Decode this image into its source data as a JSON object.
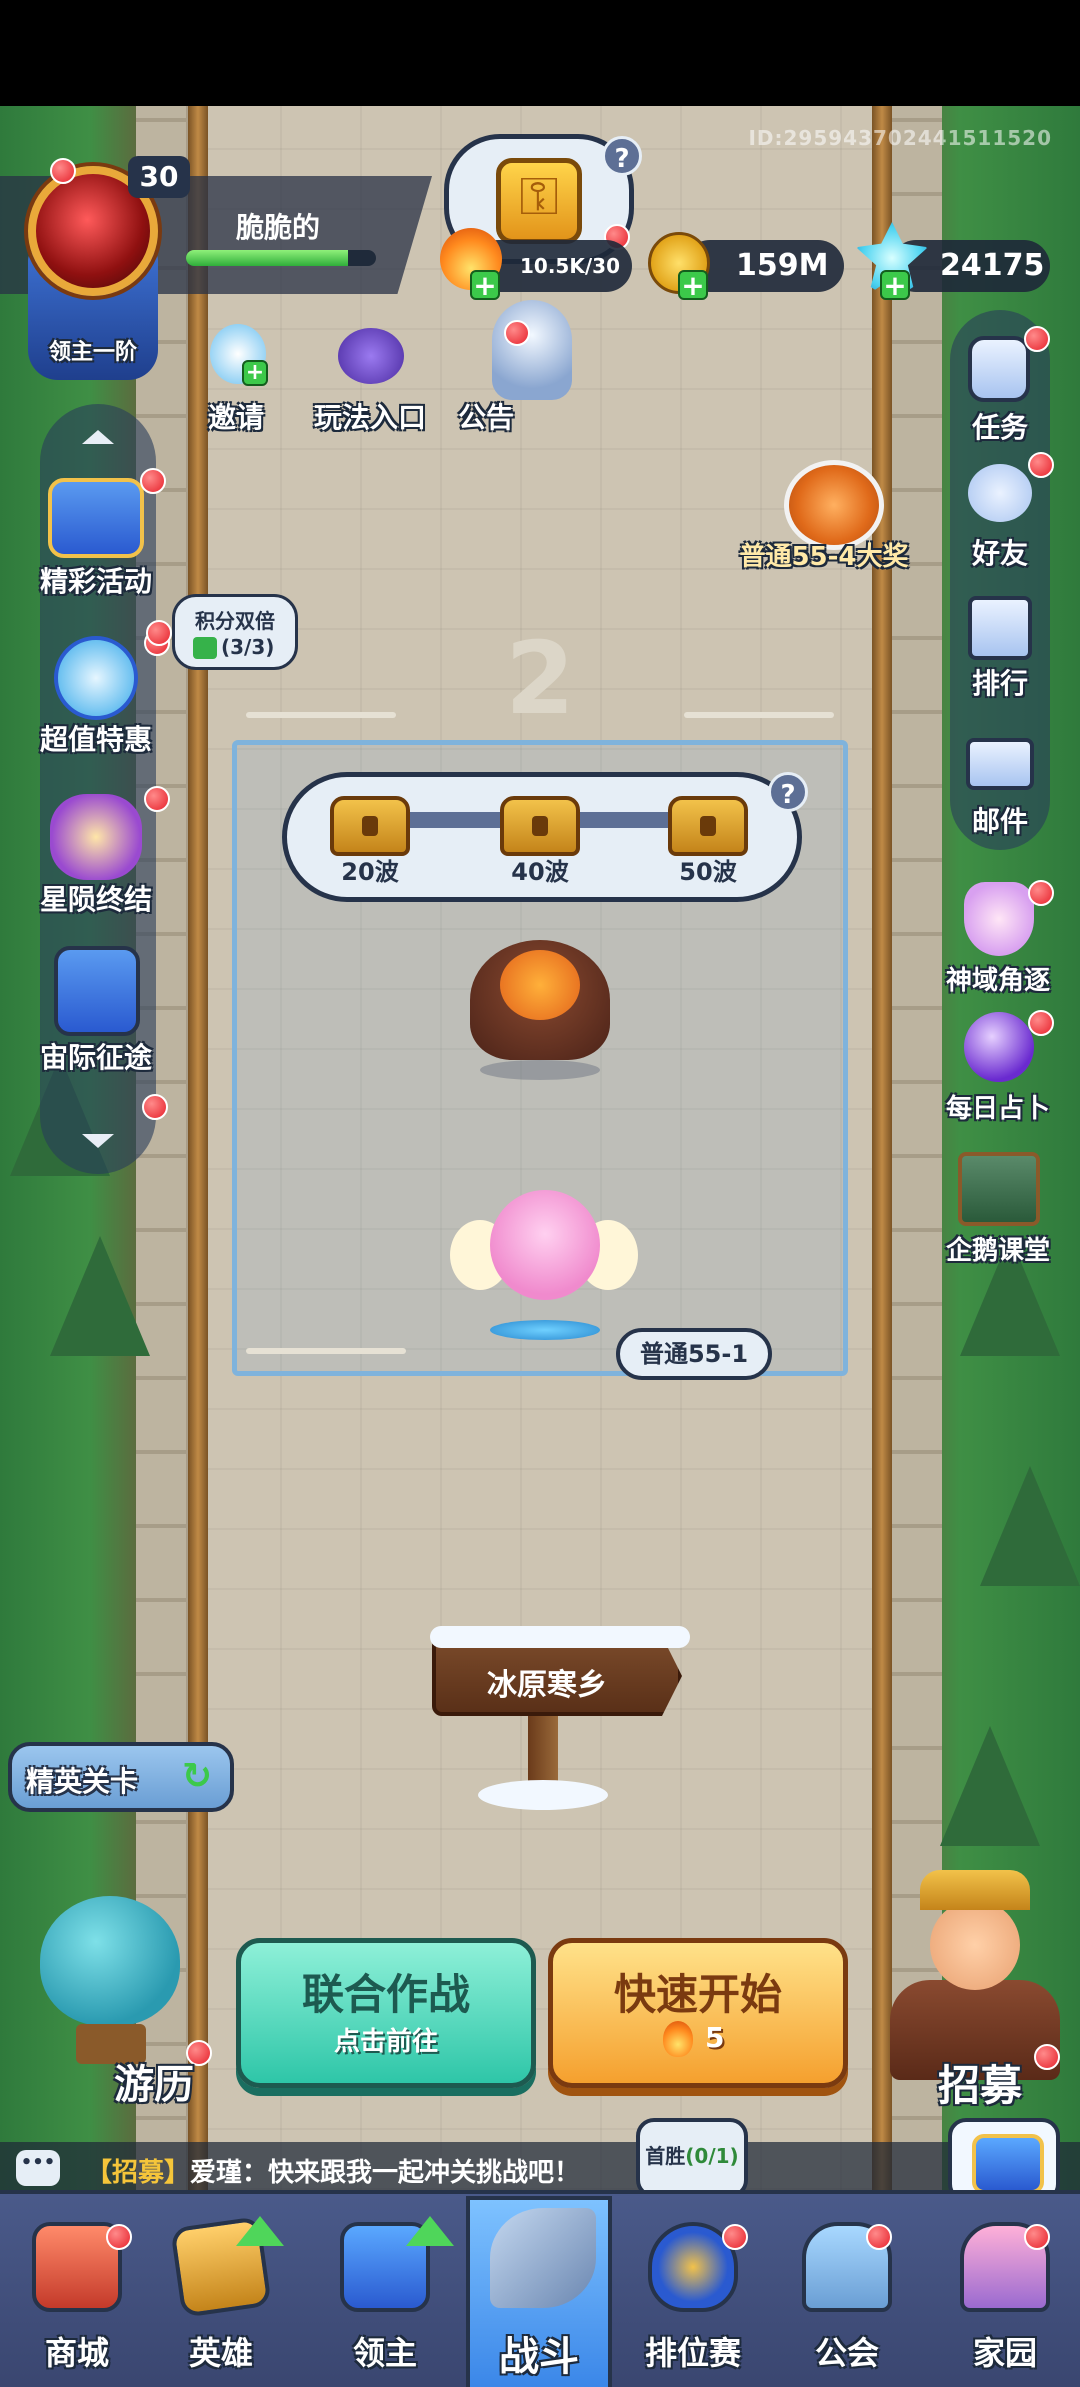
{
  "top": {
    "player_id": "ID:295943702441511520"
  },
  "player": {
    "name": "脆脆的",
    "level": "30",
    "rank": "领主一阶",
    "exp_fraction": 0.85
  },
  "resources": {
    "energy": "10.5K/30",
    "gold": "159M",
    "gems": "24175",
    "help": "?"
  },
  "top_shortcuts": [
    {
      "label": "邀请",
      "icon": "penguin-invite-icon"
    },
    {
      "label": "玩法入口",
      "icon": "gamepad-monster-icon"
    },
    {
      "label": "公告",
      "icon": "announcement-npc-icon"
    }
  ],
  "left_menu": [
    {
      "label": "精彩活动",
      "icon": "event-chest-icon"
    },
    {
      "label": "超值特惠",
      "icon": "clock-deal-icon"
    },
    {
      "label": "星陨终结",
      "icon": "star-fall-icon"
    },
    {
      "label": "宙际征途",
      "icon": "journey-checklist-icon"
    }
  ],
  "double_points": {
    "title": "积分双倍",
    "count": "(3/3)"
  },
  "right_menu": [
    {
      "label": "任务",
      "icon": "task-clipboard-icon"
    },
    {
      "label": "好友",
      "icon": "friends-icon"
    },
    {
      "label": "排行",
      "icon": "rank-trophy-icon"
    },
    {
      "label": "邮件",
      "icon": "mail-icon"
    },
    {
      "label": "神域角逐",
      "icon": "divine-arena-icon"
    },
    {
      "label": "每日占卜",
      "icon": "crystal-ball-icon"
    },
    {
      "label": "企鹅课堂",
      "icon": "penguin-class-icon"
    }
  ],
  "grand_prize": "普通55-4大奖",
  "stage": {
    "number": "2",
    "rewards": [
      "20波",
      "40波",
      "50波"
    ],
    "reward_progress": 0.0,
    "current": "普通55-1"
  },
  "map_sign": "冰原寒乡",
  "elite": "精英关卡",
  "travel": "游历",
  "coop": {
    "title": "联合作战",
    "subtitle": "点击前往"
  },
  "quick_start": {
    "title": "快速开始",
    "cost": "5"
  },
  "recruit": "招募",
  "chat": {
    "tag": "【招募】",
    "message": "爱瑾：快来跟我一起冲关挑战吧！"
  },
  "first_win": {
    "label": "首胜",
    "count": "(0/1)"
  },
  "nav": [
    {
      "label": "商城",
      "icon": "shop-icon"
    },
    {
      "label": "英雄",
      "icon": "hero-card-icon"
    },
    {
      "label": "领主",
      "icon": "lord-banner-icon"
    },
    {
      "label": "战斗",
      "icon": "battle-swords-icon"
    },
    {
      "label": "排位赛",
      "icon": "ranked-shield-icon"
    },
    {
      "label": "公会",
      "icon": "guild-castle-icon"
    },
    {
      "label": "家园",
      "icon": "home-castle-icon"
    }
  ],
  "colors": {
    "accent": "#3a86e8",
    "coop": "#2ec6a8",
    "quick": "#f5a02e",
    "notify": "#e6202a"
  }
}
